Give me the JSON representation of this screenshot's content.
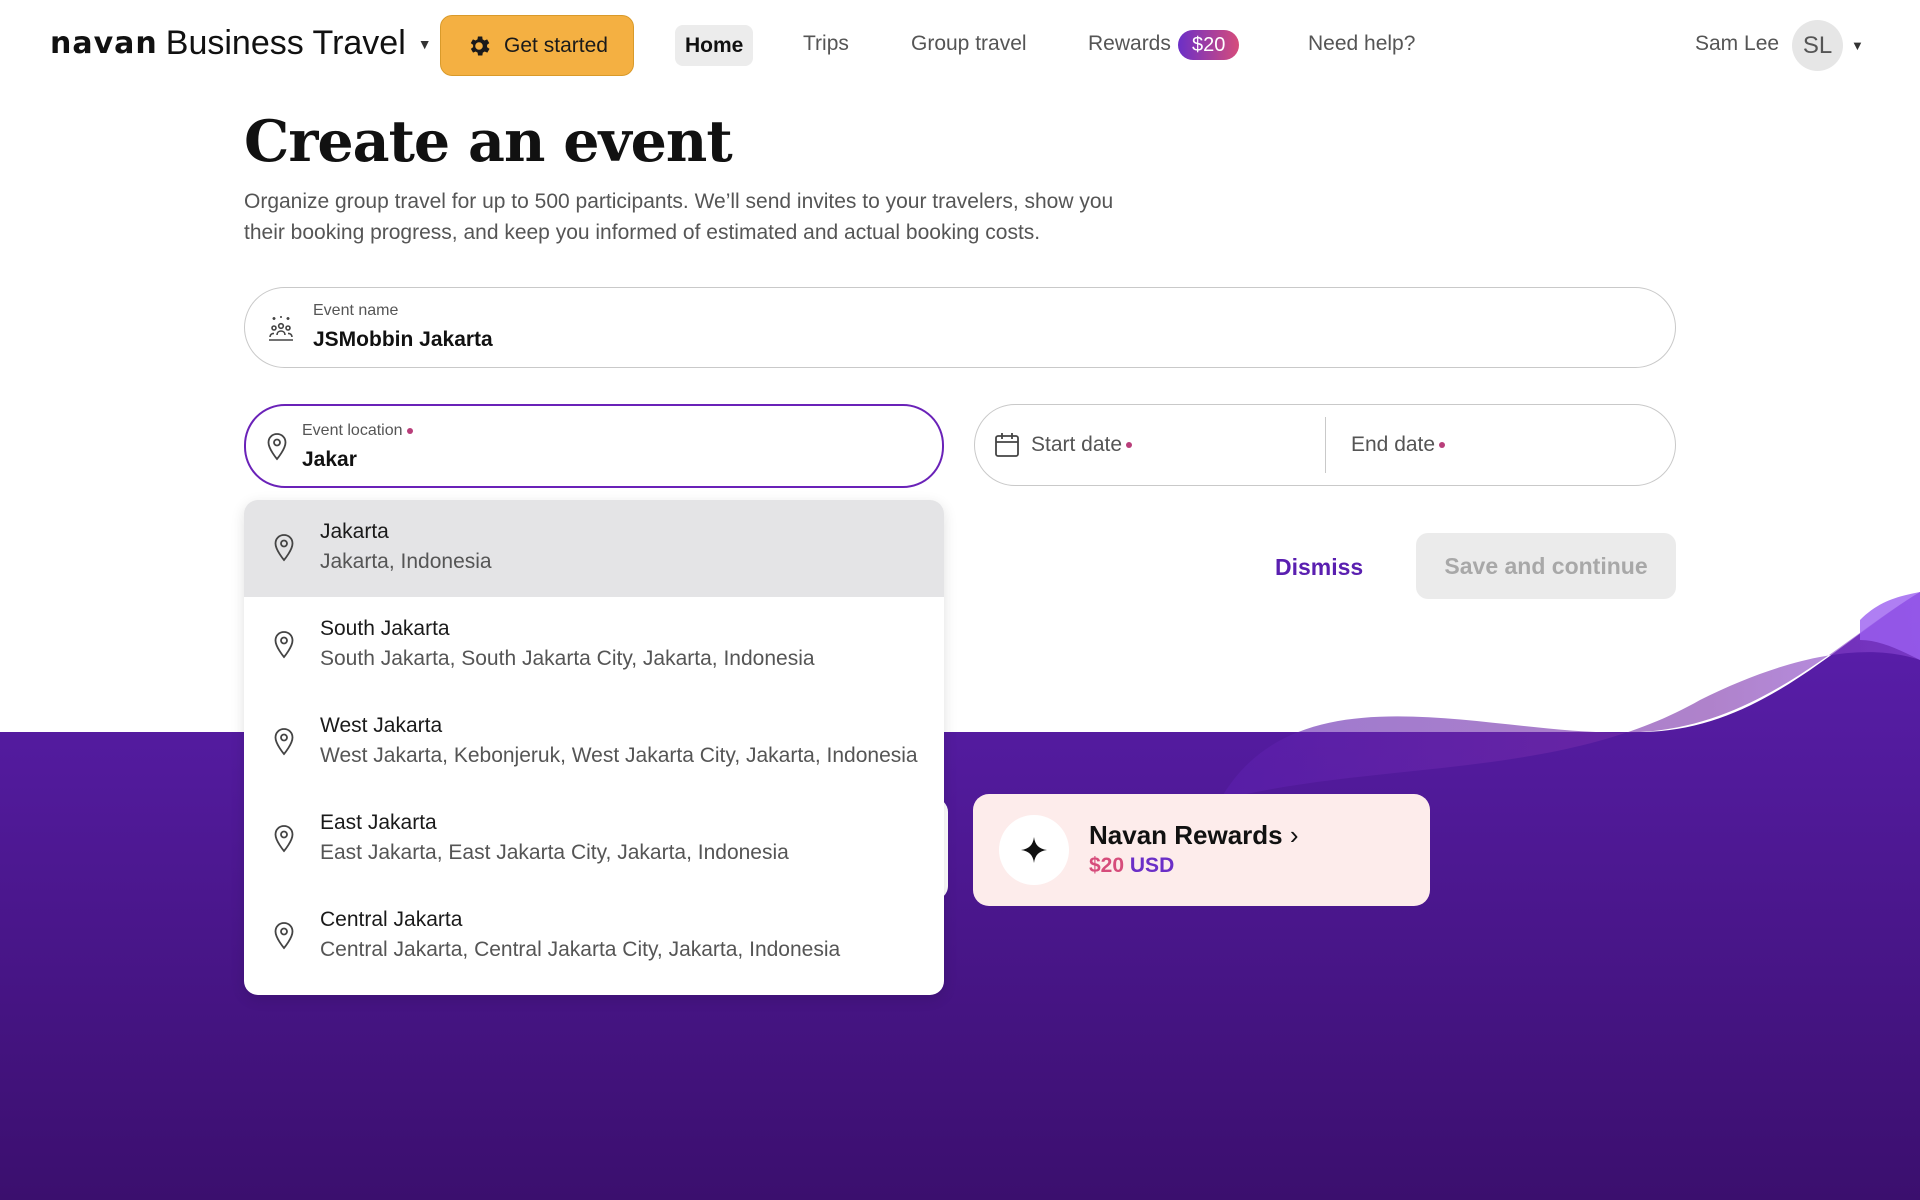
{
  "header": {
    "logo_text": "navan",
    "product": "Business Travel",
    "get_started": "Get started",
    "nav": {
      "home": "Home",
      "trips": "Trips",
      "group_travel": "Group travel",
      "rewards": "Rewards",
      "rewards_badge": "$20",
      "help": "Need help?"
    },
    "user_name": "Sam Lee",
    "avatar_initials": "SL"
  },
  "page": {
    "title": "Create an event",
    "description": "Organize group travel for up to 500 participants. We’ll send invites to your travelers, show you their booking progress, and keep you informed of estimated and actual booking costs."
  },
  "form": {
    "event_name_label": "Event name",
    "event_name_value": "JSMobbin Jakarta",
    "location_label": "Event location",
    "location_value": "Jakar",
    "start_date_label": "Start date",
    "end_date_label": "End date",
    "dismiss": "Dismiss",
    "save": "Save and continue"
  },
  "suggestions": [
    {
      "title": "Jakarta",
      "subtitle": "Jakarta, Indonesia"
    },
    {
      "title": "South Jakarta",
      "subtitle": "South Jakarta, South Jakarta City, Jakarta, Indonesia"
    },
    {
      "title": "West Jakarta",
      "subtitle": "West Jakarta, Kebonjeruk, West Jakarta City, Jakarta, Indonesia"
    },
    {
      "title": "East Jakarta",
      "subtitle": "East Jakarta, East Jakarta City, Jakarta, Indonesia"
    },
    {
      "title": "Central Jakarta",
      "subtitle": "Central Jakarta, Central Jakarta City, Jakarta, Indonesia"
    }
  ],
  "rewards_card": {
    "title": "Navan Rewards",
    "amount": "$20",
    "currency": "USD"
  },
  "colors": {
    "accent": "#5a1fb0",
    "cta": "#f4b042",
    "background_purple": "#4a189a"
  }
}
